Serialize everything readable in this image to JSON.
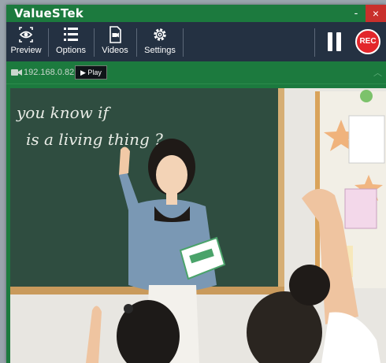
{
  "window": {
    "title": "ValueSTek",
    "minimize_glyph": "-",
    "close_glyph": "×"
  },
  "toolbar": {
    "items": [
      {
        "label": "Preview",
        "icon": "eye-icon"
      },
      {
        "label": "Options",
        "icon": "list-icon"
      },
      {
        "label": "Videos",
        "icon": "video-file-icon"
      },
      {
        "label": "Settings",
        "icon": "gear-icon"
      }
    ],
    "rec_label": "REC"
  },
  "source": {
    "ip": "192.168.0.82",
    "play_label": "▶ Play"
  },
  "video": {
    "chalk_line_1": "you know if",
    "chalk_line_2": "is a living thing ?"
  },
  "colors": {
    "accent_green": "#1c7a3e",
    "toolbar_dark": "#243142",
    "rec_red": "#e3262b"
  }
}
